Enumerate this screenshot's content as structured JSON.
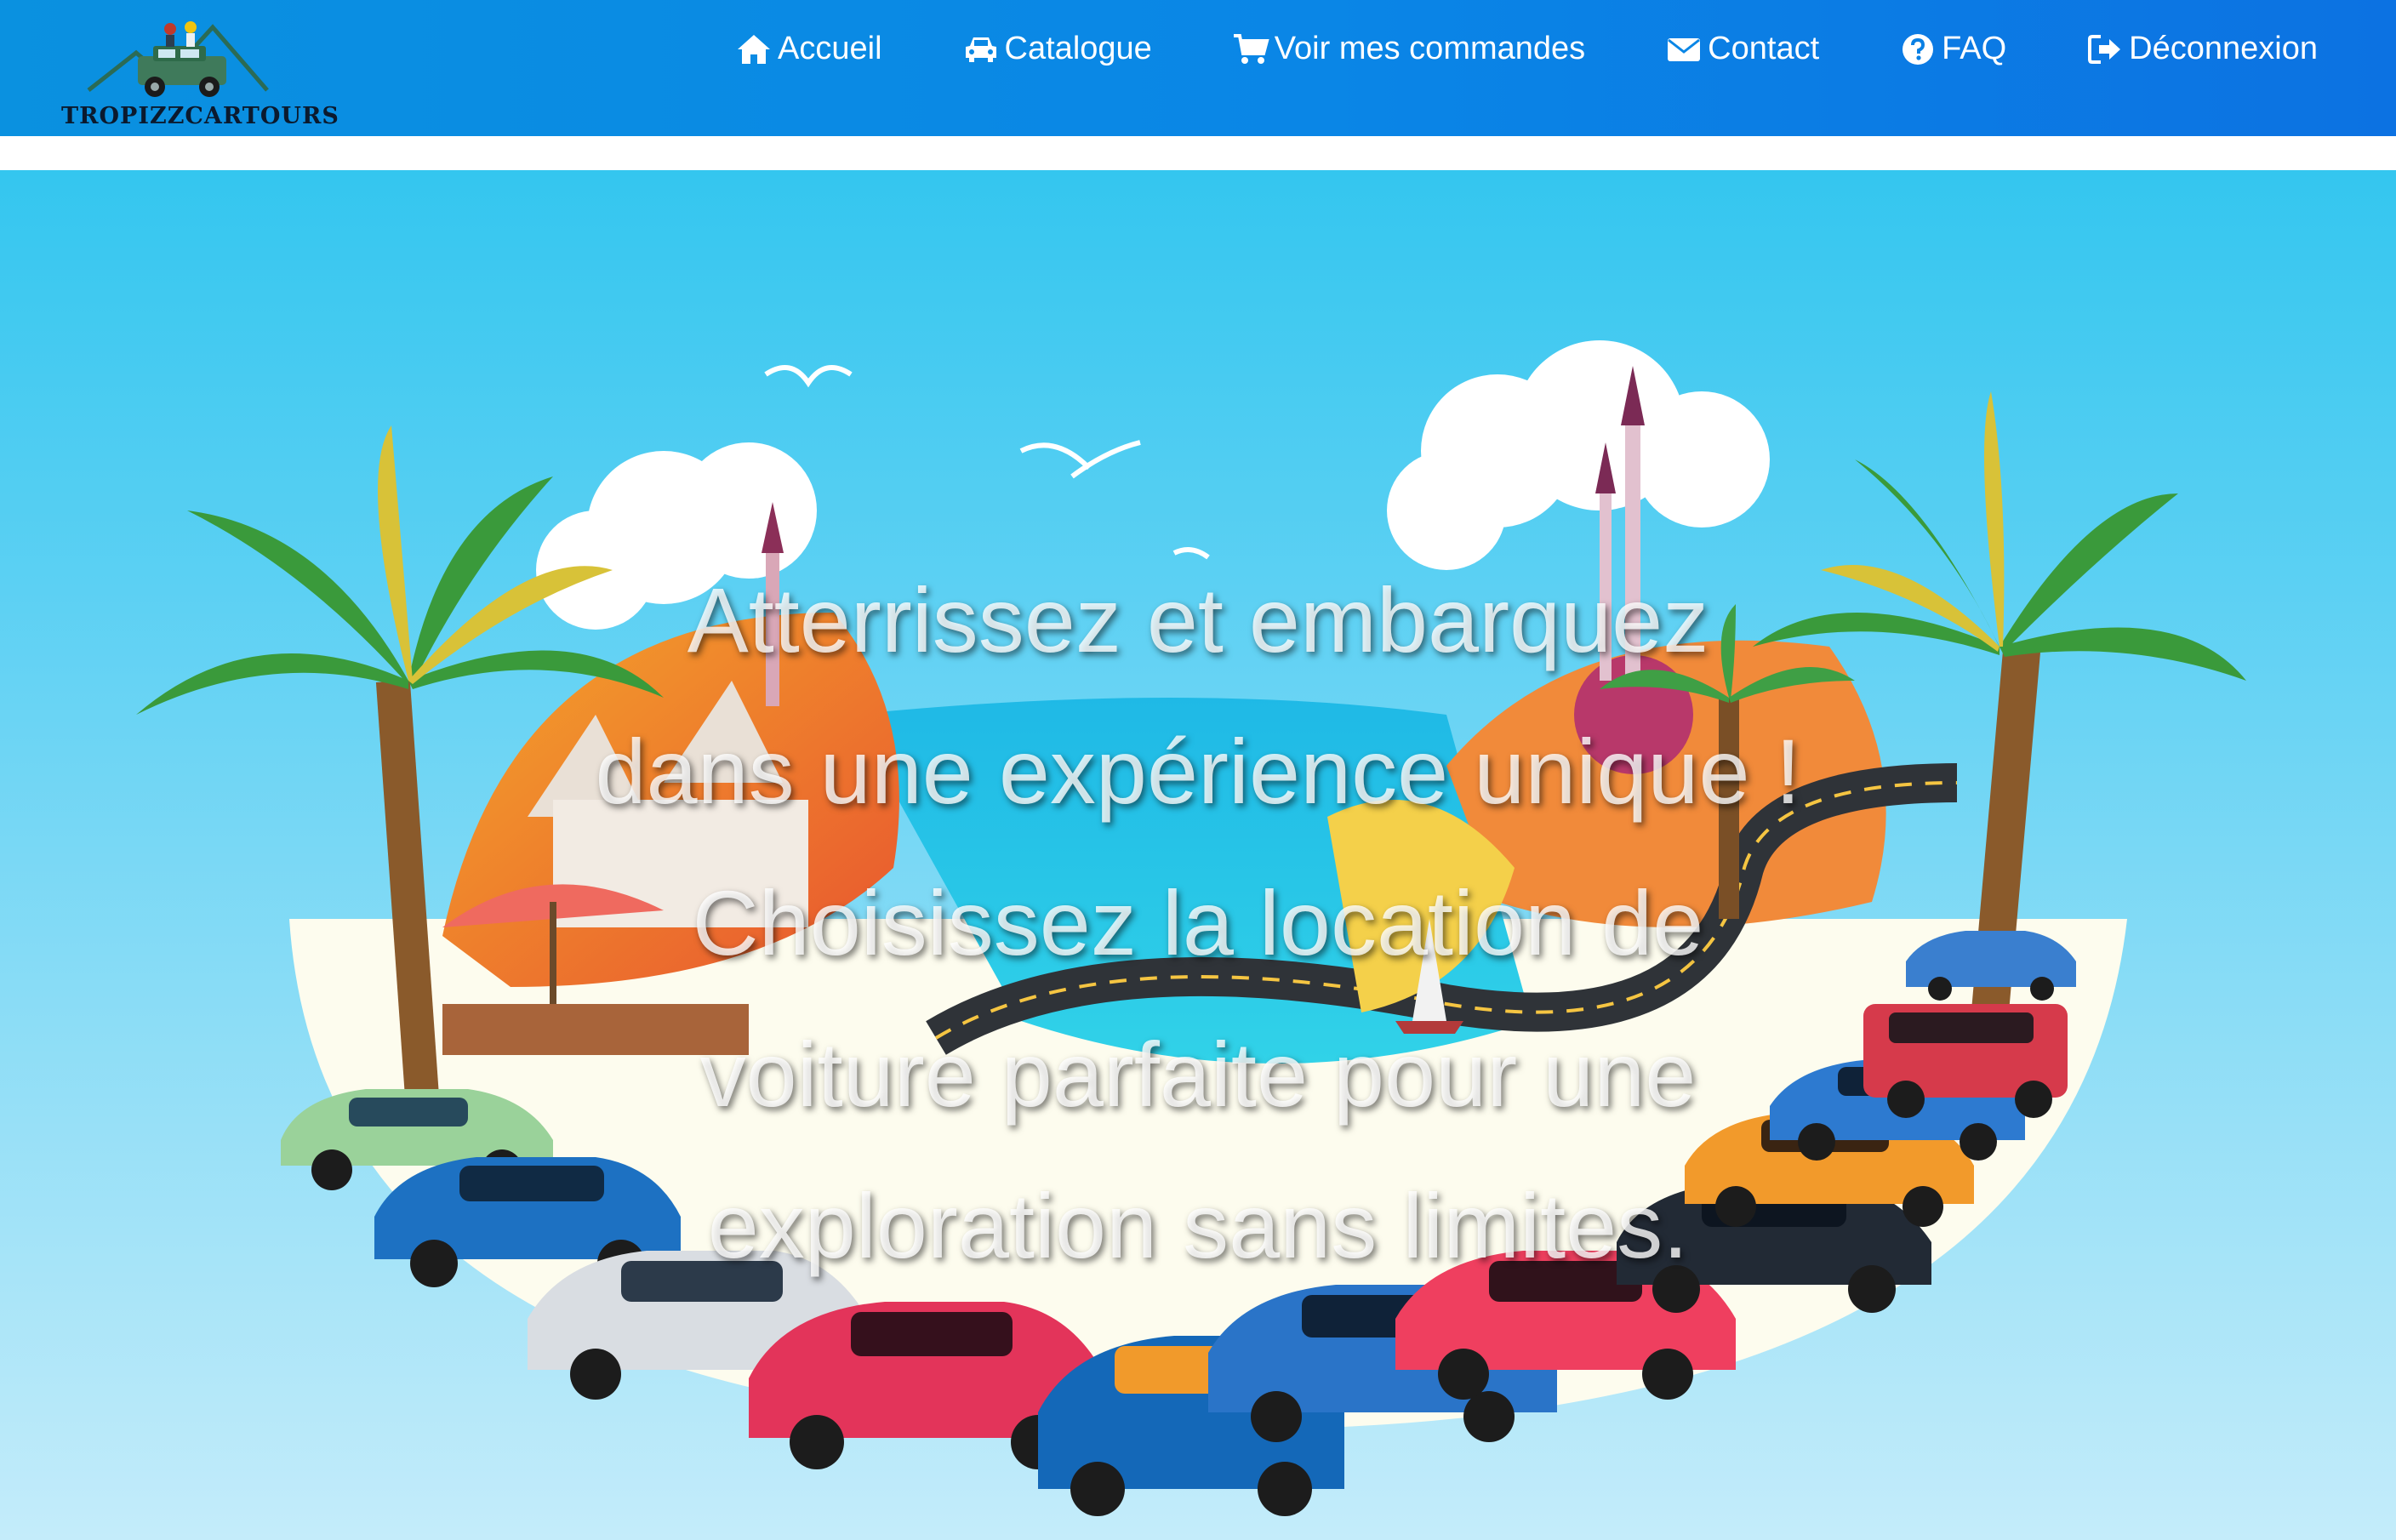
{
  "brand": {
    "name": "TROPIZZCARTOURS",
    "logo_icon": "jeep-logo-icon"
  },
  "nav": {
    "items": [
      {
        "label": "Accueil",
        "icon": "home-icon"
      },
      {
        "label": "Catalogue",
        "icon": "car-icon"
      },
      {
        "label": "Voir mes commandes",
        "icon": "cart-icon"
      },
      {
        "label": "Contact",
        "icon": "envelope-icon"
      },
      {
        "label": "FAQ",
        "icon": "question-circle-icon"
      },
      {
        "label": "Déconnexion",
        "icon": "sign-out-icon"
      }
    ]
  },
  "hero": {
    "lines": [
      "Atterrissez et embarquez",
      "dans une expérience unique !",
      "Choisissez la location de",
      "voiture parfaite pour une",
      "exploration sans limites."
    ]
  },
  "colors": {
    "navbar_start": "#0a91e0",
    "navbar_end": "#0c72e2",
    "sky": "#34c6ef",
    "text": "#ffffff"
  }
}
